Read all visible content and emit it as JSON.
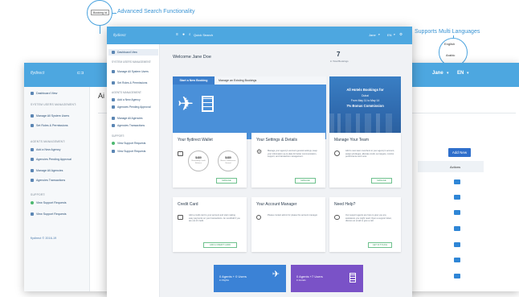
{
  "callouts": {
    "search": {
      "badge": "Booking Id",
      "text": "Advanced Search Functionality"
    },
    "languages": {
      "text": "Supports Multi Languages",
      "options": [
        "English",
        "Arabic"
      ]
    }
  },
  "back_window": {
    "header": {
      "logo": "flydirect",
      "user": "Jane",
      "lang": "EN"
    },
    "sidebar": {
      "dashboard": "Dashboard View",
      "sec_system": "SYSTEM USERS MANAGEMENT:",
      "manage_system_users": "Manage All System Users",
      "set_roles": "Set Roles & Permissions",
      "sec_agents": "AGENTS MANAGEMENT:",
      "add_agency": "Add a New Agency",
      "agencies_pending": "Agencies Pending Approval",
      "manage_agencies": "Manage All Agencies",
      "agencies_transactions": "Agencies Transactions",
      "sec_support": "SUPPORT:",
      "view_support": "View Support Requests",
      "view_support2": "View Support Requests",
      "footer": "flydirect © 2016-19"
    },
    "main": {
      "title_fragment": "Ai",
      "add_new": "Add New",
      "actions_header": "Actions"
    }
  },
  "front_window": {
    "header": {
      "logo": "flydirect",
      "search_placeholder": "Quick Search",
      "user": "Jane",
      "lang": "EN"
    },
    "sidebar": {
      "dashboard": "Dashboard View",
      "sec_system": "SYSTEM USERS MANAGEMENT:",
      "manage_system_users": "Manage All System Users",
      "set_roles": "Set Roles & Permissions",
      "sec_agents": "AGENTS MANAGEMENT:",
      "add_agency": "Add a New Agency",
      "agencies_pending": "Agencies Pending Approval",
      "manage_agencies": "Manage All Agencies",
      "agencies_transactions": "Agencies Transactions",
      "sec_support": "SUPPORT:",
      "view_support": "View Support Requests",
      "view_support2": "View Support Requests"
    },
    "welcome": "Welcome Jane Doe",
    "total_bookings": {
      "value": "7",
      "label": "in Total Bookings"
    },
    "booking_tabs": {
      "new": "Start a New Booking",
      "manage": "Manage an Existing Bookings"
    },
    "promo": {
      "title": "All Hotels Bookings for",
      "city": "Dubai",
      "dates": "From May 11 to May 14",
      "commission": "7% Bonus Commission"
    },
    "wallet": {
      "title": "Your flydirect Wallet",
      "balance1": "$480",
      "balance1_label": "Remaining Credit Balance",
      "balance2": "$480",
      "balance2_label": "Bonus Commission Earned",
      "button": "MANAGE"
    },
    "settings": {
      "title": "Your Settings & Details",
      "body": "Manage your agency's account general settings, keep your information up-to-date for better communication, support, and transaction management.",
      "button": "MANAGE"
    },
    "team": {
      "title": "Manage Your Team",
      "body": "Add to new team members to your agency's account, assign privileges, allocate credit, set targets, monitor performance and more.",
      "button": "MANAGE"
    },
    "credit": {
      "title": "Credit Card",
      "body": "Add a credit card to your account and start making easy payments on your transactions. An overdraft if you are out of credit.",
      "button": "ADD A CREDIT CARD"
    },
    "manager": {
      "title": "Your Account Manager",
      "body": "Please contact admin for please the account manager."
    },
    "help": {
      "title": "Need Help?",
      "body": "Our support agents are here to give you any assistance you might need. Open a support ticket, discuss an email or give a call.",
      "button": "GET IN TOUCH"
    },
    "stats": {
      "flights": {
        "line1": "0 Agents + 0 Users",
        "line2": "in Flights"
      },
      "hotels": {
        "line1": "0 Agents +7 Users",
        "line2": "in Hotels"
      }
    }
  },
  "colors": {
    "header_blue": "#4da7e0",
    "promo_blue": "#3a7fc4",
    "banner_blue": "#4a90d9",
    "flights_tile": "#3b82d6",
    "hotels_tile": "#7a52c7",
    "accent_green": "#4cb86f"
  }
}
